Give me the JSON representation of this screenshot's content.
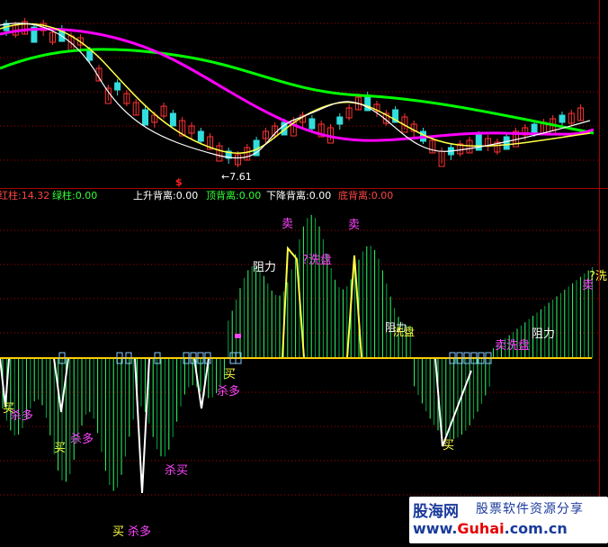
{
  "colors": {
    "background": "#000000",
    "grid": "#b00000",
    "ma_magenta": "#ff00ff",
    "ma_green": "#00ff00",
    "ma_yellow": "#ffff44",
    "ma_white": "#ffffff",
    "candle_up": "#ff3333",
    "candle_down": "#33dddd",
    "bar_up_green": "#33ff66",
    "bar_down_green": "#00aa44",
    "zero_line": "#ffcc00",
    "signal_buy": "#ffff44",
    "signal_sell": "#ff44ff"
  },
  "upper_panel": {
    "low_marker": "←7.61",
    "flag_marker": "$"
  },
  "status_bar": {
    "red_bar": "红柱:14.32",
    "green_bar": "绿柱:0.00",
    "rise_divergence": "上升背离:0.00",
    "top_divergence": "顶背离:0.00",
    "fall_divergence": "下降背离:0.00",
    "bottom_divergence": "底背离:0.00"
  },
  "labels": {
    "buy": "买",
    "kill_long": "杀多",
    "sell": "卖",
    "wash": "洗盘",
    "wash_q": "?洗盘",
    "resistance": "阻力",
    "kill_buy": "杀买",
    "sell_wash": "卖洗盘",
    "q_wash_cut": "?洗"
  },
  "watermark": {
    "logo": "股海网",
    "slogan": "股票软件资源分享",
    "url_prefix": "www.",
    "url_brand": "Guhai",
    "url_suffix": ".com.cn"
  }
}
